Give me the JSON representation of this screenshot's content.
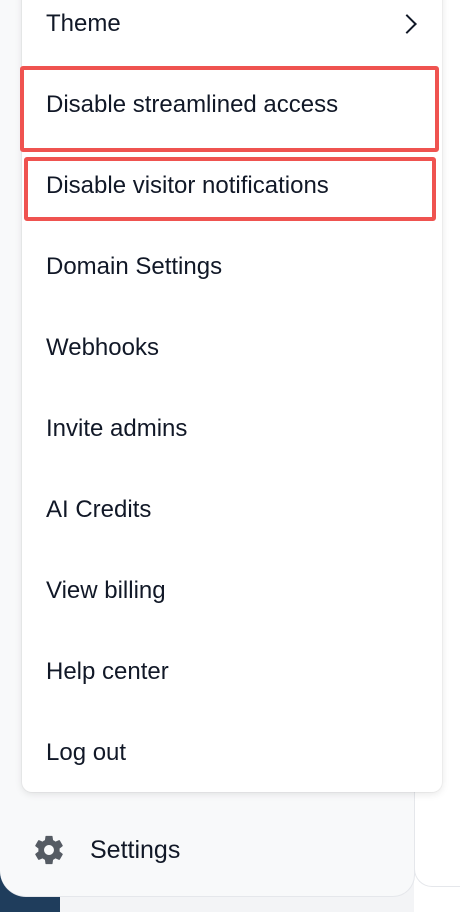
{
  "menu": {
    "items": [
      {
        "label": "Theme",
        "has_submenu": true
      },
      {
        "label": "Disable streamlined access",
        "highlighted": true
      },
      {
        "label": "Disable visitor notifications",
        "highlighted": true
      },
      {
        "label": "Domain Settings"
      },
      {
        "label": "Webhooks"
      },
      {
        "label": "Invite admins"
      },
      {
        "label": "AI Credits"
      },
      {
        "label": "View billing"
      },
      {
        "label": "Help center"
      },
      {
        "label": "Log out"
      }
    ]
  },
  "sidebar": {
    "settings_label": "Settings",
    "settings_icon": "gear-icon"
  },
  "colors": {
    "highlight": "#ef5350",
    "text": "#111827",
    "menu_bg": "#ffffff",
    "sidebar_bg": "#f8f9fa",
    "corner_bg": "#1f3d5c"
  }
}
